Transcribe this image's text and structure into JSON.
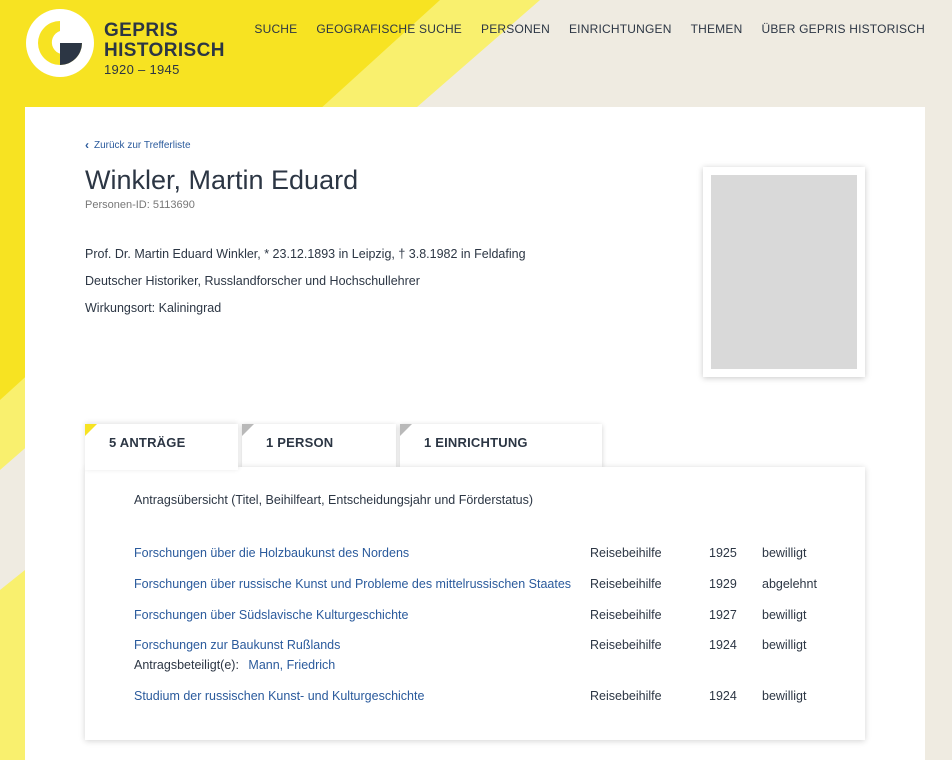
{
  "colors": {
    "accent_yellow": "#f7e322",
    "navy": "#2c3644",
    "link_blue": "#2a5a9c",
    "background": "#efebe1"
  },
  "logo": {
    "line1": "GEPRIS",
    "line2": "HISTORISCH",
    "line3": "1920 – 1945"
  },
  "nav": [
    "SUCHE",
    "GEOGRAFISCHE SUCHE",
    "PERSONEN",
    "EINRICHTUNGEN",
    "THEMEN",
    "ÜBER GEPRIS HISTORISCH"
  ],
  "back_link": "Zurück zur Trefferliste",
  "person": {
    "name": "Winkler, Martin Eduard",
    "id_label": "Personen-ID: 5113690",
    "bio": "Prof. Dr. Martin Eduard Winkler, * 23.12.1893 in Leipzig, † 3.8.1982 in Feldafing",
    "profession": "Deutscher Historiker, Russlandforscher und Hochschullehrer",
    "place": "Wirkungsort: Kaliningrad"
  },
  "tabs": [
    {
      "label": "5 ANTRÄGE",
      "active": true
    },
    {
      "label": "1 PERSON",
      "active": false
    },
    {
      "label": "1 EINRICHTUNG",
      "active": false
    }
  ],
  "panel": {
    "title": "Antragsübersicht (Titel, Beihilfeart, Entscheidungsjahr und Förderstatus)",
    "rows": [
      {
        "title": "Forschungen über die Holzbaukunst des Nordens",
        "type": "Reisebeihilfe",
        "year": "1925",
        "status": "bewilligt"
      },
      {
        "title": "Forschungen über russische Kunst und Probleme des mittelrussischen Staates",
        "type": "Reisebeihilfe",
        "year": "1929",
        "status": "abgelehnt"
      },
      {
        "title": "Forschungen über Südslavische Kulturgeschichte",
        "type": "Reisebeihilfe",
        "year": "1927",
        "status": "bewilligt"
      },
      {
        "title": "Forschungen zur Baukunst Rußlands",
        "type": "Reisebeihilfe",
        "year": "1924",
        "status": "bewilligt",
        "participant_label": "Antragsbeteiligt(e):",
        "participant": "Mann, Friedrich"
      },
      {
        "title": "Studium der russischen Kunst- und Kulturgeschichte",
        "type": "Reisebeihilfe",
        "year": "1924",
        "status": "bewilligt"
      }
    ]
  }
}
